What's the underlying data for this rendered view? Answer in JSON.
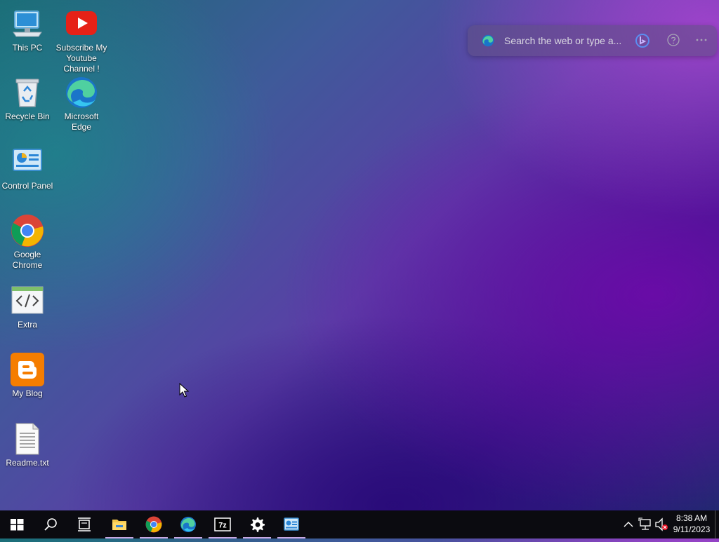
{
  "desktop": {
    "icons": [
      {
        "name": "This PC",
        "key": "this-pc"
      },
      {
        "name": "Subscribe My Youtube Channel !",
        "key": "youtube"
      },
      {
        "name": "Recycle Bin",
        "key": "recycle-bin"
      },
      {
        "name": "Microsoft Edge",
        "key": "edge"
      },
      {
        "name": "Control Panel",
        "key": "control-panel"
      },
      {
        "name": "Google Chrome",
        "key": "chrome"
      },
      {
        "name": "Extra",
        "key": "extra"
      },
      {
        "name": "My Blog",
        "key": "blog"
      },
      {
        "name": "Readme.txt",
        "key": "readme"
      }
    ]
  },
  "search_widget": {
    "placeholder": "Search the web or type a...",
    "icons": [
      "edge-icon",
      "bing-icon",
      "help-icon",
      "more-icon"
    ]
  },
  "taskbar": {
    "pinned": [
      {
        "key": "start",
        "icon": "windows-logo-icon"
      },
      {
        "key": "search",
        "icon": "search-icon"
      },
      {
        "key": "task-view",
        "icon": "task-view-icon"
      },
      {
        "key": "file-explorer",
        "icon": "folder-icon"
      },
      {
        "key": "chrome",
        "icon": "chrome-icon"
      },
      {
        "key": "edge",
        "icon": "edge-icon"
      },
      {
        "key": "7zip",
        "icon": "7zip-icon"
      },
      {
        "key": "settings",
        "icon": "gear-icon"
      },
      {
        "key": "control-panel",
        "icon": "control-panel-icon"
      }
    ],
    "tray_icons": [
      "chevron-up-icon",
      "network-icon",
      "volume-muted-icon"
    ],
    "clock": {
      "time": "8:38 AM",
      "date": "9/11/2023"
    }
  },
  "colors": {
    "taskbar_bg": "#0b0b10",
    "running_indicator": "#c7a8e2",
    "youtube_red": "#e62117",
    "blogger_orange": "#f57d00"
  }
}
